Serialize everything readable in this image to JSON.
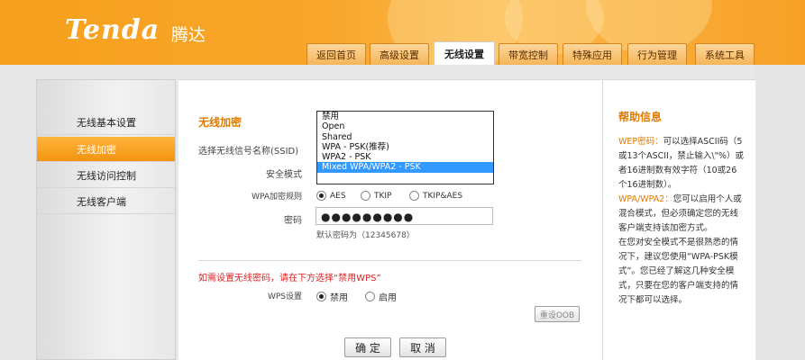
{
  "header": {
    "logo": "Tenda",
    "logo_cn": "腾达",
    "tabs": [
      {
        "label": "返回首页"
      },
      {
        "label": "高级设置"
      },
      {
        "label": "无线设置",
        "active": true
      },
      {
        "label": "带宽控制"
      },
      {
        "label": "特殊应用"
      },
      {
        "label": "行为管理"
      },
      {
        "label": "系统工具"
      }
    ]
  },
  "sidebar": {
    "items": [
      {
        "label": "无线基本设置"
      },
      {
        "label": "无线加密",
        "active": true
      },
      {
        "label": "无线访问控制"
      },
      {
        "label": "无线客户端"
      }
    ]
  },
  "main": {
    "section_title": "无线加密",
    "ssid_label": "选择无线信号名称(SSID)",
    "security_label": "安全模式",
    "dropdown_options": [
      "禁用",
      "Open",
      "Shared",
      "WPA - PSK(推荐)",
      "WPA2 - PSK",
      "Mixed WPA/WPA2 - PSK"
    ],
    "selected_option": "Mixed WPA/WPA2 - PSK",
    "cipher_label": "WPA加密规则",
    "cipher_options": [
      "AES",
      "TKIP",
      "TKIP&AES"
    ],
    "cipher_selected": "AES",
    "password_label": "密码",
    "password_value": "●●●●●●●●●",
    "password_hint": "默认密码为（12345678）",
    "wps_warning": "如需设置无线密码，请在下方选择“禁用WPS”",
    "wps_label": "WPS设置",
    "wps_options": [
      "禁用",
      "启用"
    ],
    "wps_selected": "禁用",
    "reset_oob": "重设OOB",
    "ok_button": "确 定",
    "cancel_button": "取 消"
  },
  "help": {
    "title": "帮助信息",
    "wep_key": "WEP密码：",
    "wep_text": "可以选择ASCII码（5或13个ASCII，禁止输入\\\"%）或者16进制数有效字符（10或26个16进制数）。",
    "wpa_key": "WPA/WPA2：",
    "wpa_text": "您可以启用个人或混合模式，但必须确定您的无线客户端支持该加密方式。",
    "tip_text": "在您对安全模式不是很熟悉的情况下，建议您使用“WPA-PSK模式”。您已经了解这几种安全模式，只要在您的客户端支持的情况下都可以选择。"
  },
  "colors": {
    "accent": "#f39410",
    "title": "#e07a00",
    "warn": "#dd2222",
    "selected": "#3399ff"
  }
}
